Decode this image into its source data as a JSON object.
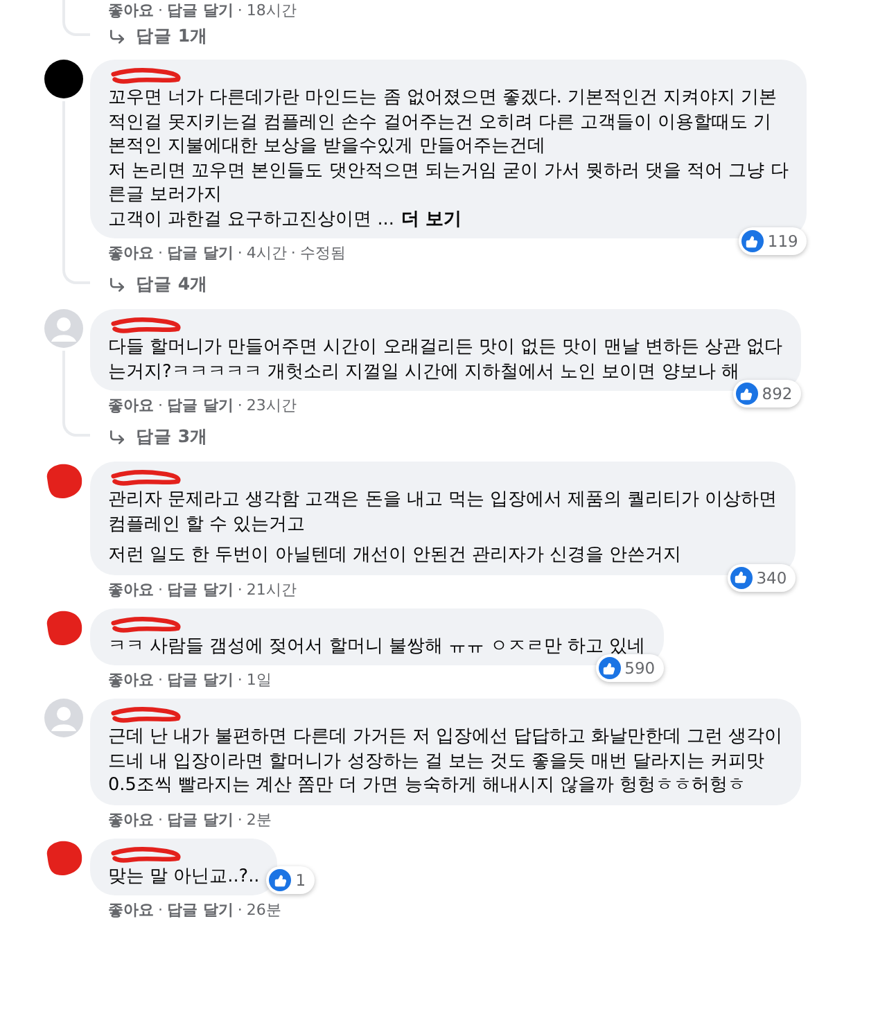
{
  "previous_comment": {
    "meta": [
      {
        "kind": "link",
        "text": "좋아요"
      },
      {
        "kind": "dot",
        "text": "·"
      },
      {
        "kind": "link",
        "text": "답글 달기"
      },
      {
        "kind": "dot",
        "text": "·"
      },
      {
        "kind": "time",
        "text": "18시간"
      }
    ],
    "replies": "답글 1개"
  },
  "comments": [
    {
      "avatar": {
        "kind": "blacked_out"
      },
      "name_scribbled": true,
      "paragraphs": [
        "꼬우면 너가 다른데가란 마인드는 좀 없어졌으면 좋겠다. 기본적인건 지켜야지 기본\n적인걸 못지키는걸 컴플레인 손수 걸어주는건 오히려 다른 고객들이 이용할때도 기\n본적인 지불에대한 보상을 받을수있게 만들어주는건데\n저 논리면 꼬우면 본인들도 댓안적으면 되는거임 굳이 가서 뭣하러 댓을 적어 그냥 다\n른글 보러가지\n고객이 과한걸 요구하고진상이면 ..."
      ],
      "more_link": "더 보기",
      "likes": "119",
      "meta": [
        {
          "kind": "link",
          "text": "좋아요"
        },
        {
          "kind": "dot",
          "text": "·"
        },
        {
          "kind": "link",
          "text": "답글 달기"
        },
        {
          "kind": "dot",
          "text": "·"
        },
        {
          "kind": "time",
          "text": "4시간"
        },
        {
          "kind": "dot",
          "text": "·"
        },
        {
          "kind": "note",
          "text": "수정됨"
        }
      ],
      "replies": "답글 4개"
    },
    {
      "avatar": {
        "kind": "default"
      },
      "name_scribbled": true,
      "paragraphs": [
        "다들 할머니가 만들어주면 시간이 오래걸리든 맛이 없든 맛이 맨날 변하든 상관 없다\n는거지?ㅋㅋㅋㅋㅋ 개헛소리 지껄일 시간에 지하철에서 노인 보이면 양보나 해"
      ],
      "likes": "892",
      "meta": [
        {
          "kind": "link",
          "text": "좋아요"
        },
        {
          "kind": "dot",
          "text": "·"
        },
        {
          "kind": "link",
          "text": "답글 달기"
        },
        {
          "kind": "dot",
          "text": "·"
        },
        {
          "kind": "time",
          "text": "23시간"
        }
      ],
      "replies": "답글 3개"
    },
    {
      "avatar": {
        "kind": "scribbled"
      },
      "name_scribbled": true,
      "paragraphs": [
        "관리자 문제라고 생각함 고객은 돈을 내고 먹는 입장에서 제품의 퀄리티가 이상하면\n컴플레인 할 수 있는거고",
        "저런 일도 한 두번이 아닐텐데 개선이 안된건 관리자가 신경을 안쓴거지"
      ],
      "likes": "340",
      "meta": [
        {
          "kind": "link",
          "text": "좋아요"
        },
        {
          "kind": "dot",
          "text": "·"
        },
        {
          "kind": "link",
          "text": "답글 달기"
        },
        {
          "kind": "dot",
          "text": "·"
        },
        {
          "kind": "time",
          "text": "21시간"
        }
      ]
    },
    {
      "avatar": {
        "kind": "scribbled"
      },
      "name_scribbled": true,
      "paragraphs": [
        "ㅋㅋ 사람들 갬성에 젖어서 할머니 불쌍해 ㅠㅠ ㅇㅈㄹ만 하고 있네"
      ],
      "likes": "590",
      "meta": [
        {
          "kind": "link",
          "text": "좋아요"
        },
        {
          "kind": "dot",
          "text": "·"
        },
        {
          "kind": "link",
          "text": "답글 달기"
        },
        {
          "kind": "dot",
          "text": "·"
        },
        {
          "kind": "time",
          "text": "1일"
        }
      ]
    },
    {
      "avatar": {
        "kind": "default"
      },
      "name_scribbled": true,
      "paragraphs": [
        "근데 난 내가 불편하면 다른데 가거든 저 입장에선 답답하고 화날만한데 그런 생각이\n드네 내 입장이라면 할머니가 성장하는 걸 보는 것도 좋을듯 매번 달라지는 커피맛\n0.5조씩 빨라지는 계산 쫌만 더 가면 능숙하게 해내시지 않을까 헝헝ㅎㅎ허헝ㅎ"
      ],
      "meta": [
        {
          "kind": "link",
          "text": "좋아요"
        },
        {
          "kind": "dot",
          "text": "·"
        },
        {
          "kind": "link",
          "text": "답글 달기"
        },
        {
          "kind": "dot",
          "text": "·"
        },
        {
          "kind": "time",
          "text": "2분"
        }
      ]
    },
    {
      "avatar": {
        "kind": "scribbled"
      },
      "name_scribbled": true,
      "paragraphs": [
        "맞는 말 아닌교..?.."
      ],
      "likes": "1",
      "meta": [
        {
          "kind": "link",
          "text": "좋아요"
        },
        {
          "kind": "dot",
          "text": "·"
        },
        {
          "kind": "link",
          "text": "답글 달기"
        },
        {
          "kind": "dot",
          "text": "·"
        },
        {
          "kind": "time",
          "text": "26분"
        }
      ]
    }
  ]
}
